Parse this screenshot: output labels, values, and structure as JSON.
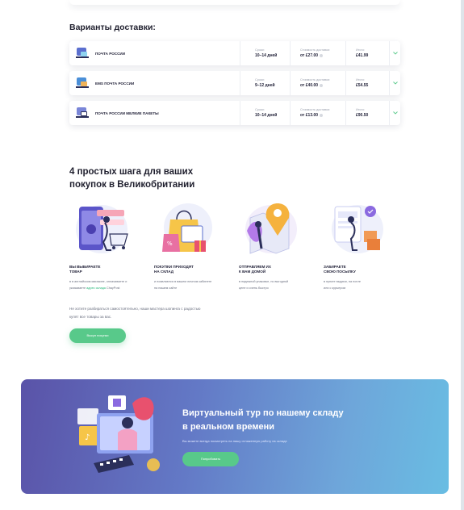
{
  "delivery": {
    "title": "Варианты доставки:",
    "labels": {
      "term": "Сроки:",
      "cost": "Стоимость доставки:",
      "total": "Итого:"
    },
    "rows": [
      {
        "name": "ПОЧТА РОССИИ",
        "term": "10–14 дней",
        "cost": "от £27.00",
        "total": "£41.99"
      },
      {
        "name": "EMS ПОЧТА РОССИИ",
        "term": "9–12 дней",
        "cost": "от £40.00",
        "total": "£54.55"
      },
      {
        "name": "ПОЧТА РОССИИ МЕЛКИЕ ПАКЕТЫ",
        "term": "10–14 дней",
        "cost": "от £13.00",
        "total": "£90.50"
      }
    ]
  },
  "steps": {
    "title_line1": "4 простых шага для ваших",
    "title_line2": "покупок в Великобритании",
    "items": [
      {
        "title_line1": "ВЫ ВЫБИРАЕТЕ",
        "title_line2": "ТОВАР",
        "text_line1": "в в английском магазине, оплачиваете и",
        "text_pre": "указываете ",
        "text_link": "адрес склада",
        "text_post": " ChayPost"
      },
      {
        "title_line1": "ПОКУПКИ ПРИХОДЯТ",
        "title_line2": "НА СКЛАД",
        "text_line1": "и появляются в вашем личном кабинете",
        "text_pre": "на нашем сайте",
        "text_link": "",
        "text_post": ""
      },
      {
        "title_line1": "ОТПРАВЛЯЕМ ИХ",
        "title_line2": "К ВАМ ДОМОЙ",
        "text_line1": "в надежной упаковке, по выгодной",
        "text_pre": "цене и очень быстро",
        "text_link": "",
        "text_post": ""
      },
      {
        "title_line1": "ЗАБИРАЕТЕ",
        "title_line2": "СВОЮ ПОСЫЛКУ",
        "text_line1": "в пункте выдачи, на почте",
        "text_pre": "или с курьером",
        "text_link": "",
        "text_post": ""
      }
    ],
    "note_line1": "Не хотите разбираться самостоятельно, наши мастера шопинга с радостью",
    "note_line2": "купят все товары за вас.",
    "button": "Выкуп покупки"
  },
  "banner": {
    "title_line1": "Виртуальный тур по нашему складу",
    "title_line2": "в реальном времени",
    "text": "Вы можете всегда посмотреть на нашу отлаженную работу на складе",
    "button": "Попробовать"
  },
  "colors": {
    "accent_green": "#58c98a",
    "link_green": "#27b77a",
    "banner_start": "#5a53a8",
    "banner_end": "#69bde3"
  }
}
